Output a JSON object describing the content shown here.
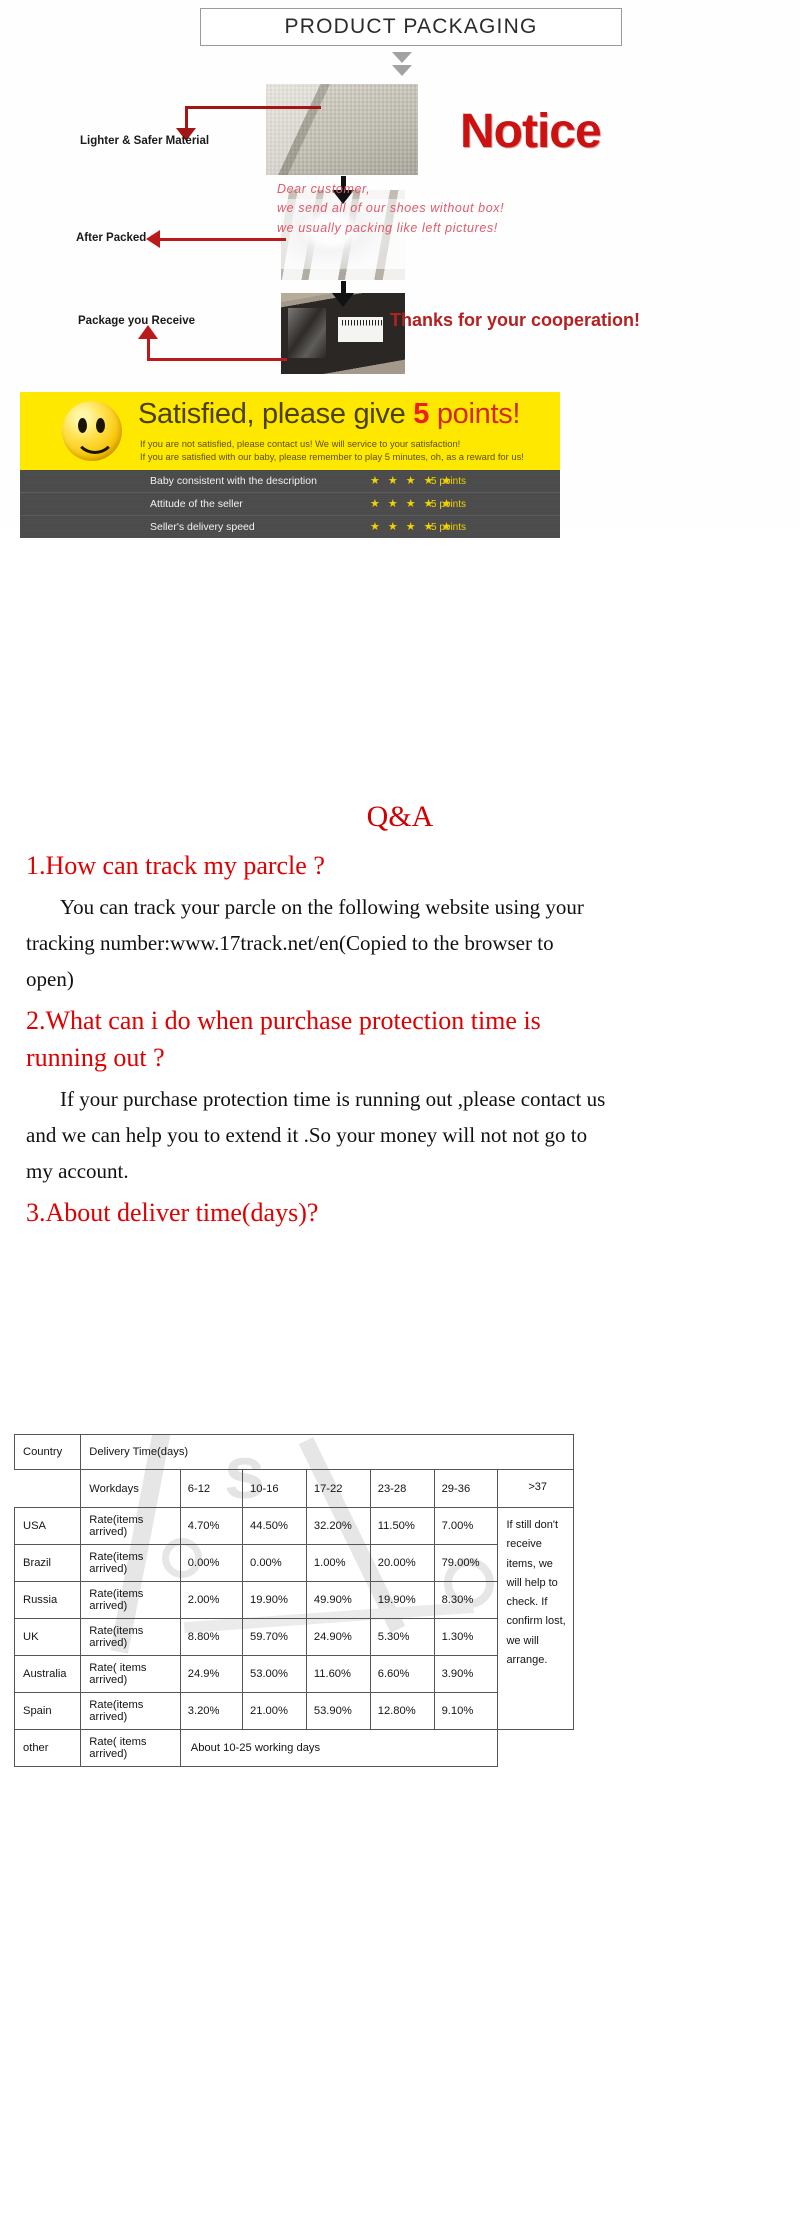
{
  "packaging": {
    "title": "PRODUCT  PACKAGING",
    "notice_heading": "Notice",
    "labels": [
      "Lighter & Safer Material",
      "After Packed",
      "Package you Receive"
    ],
    "handwriting": [
      "Dear customer,",
      "we send all of our shoes without box!",
      "we usually packing like left pictures!"
    ],
    "thanks": "Thanks for your cooperation!",
    "icons": {
      "down_arrow": "down-arrow-icon",
      "red_pointer": "red-arrow-icon"
    }
  },
  "feedback": {
    "headline_main": "Satisfied, please give ",
    "headline_points_number": "5",
    "headline_points_word": " points",
    "headline_excl": "!",
    "sub_line_1": "If you are not satisfied, please contact us! We will service to your satisfaction!",
    "sub_line_2": "If you are satisfied with our baby, please remember to play 5 minutes, oh, as a reward for us!",
    "smiley_icon": "smiley-face-icon",
    "rows": [
      {
        "label": "Baby consistent with the description",
        "stars": 5,
        "points": "5 points"
      },
      {
        "label": "Attitude of the seller",
        "stars": 5,
        "points": "5 points"
      },
      {
        "label": "Seller's delivery speed",
        "stars": 5,
        "points": "5 points"
      }
    ],
    "star_glyph": "★",
    "colors": {
      "banner": "#ffe800",
      "rows": "#4a4a4a",
      "star": "#f2d300",
      "points_red": "#ef1d1d"
    }
  },
  "qa": {
    "title": "Q&A",
    "q1": "1.How can track my parcle ?",
    "a1_line1": "You can track your parcle on the following website using your",
    "a1_line2": "tracking number:www.17track.net/en(Copied to the browser to",
    "a1_line3": "open)",
    "q2_line1": "2.What can i do when purchase protection time is",
    "q2_line2": "running out ?",
    "a2_line1": "If your purchase protection time is running out ,please contact us",
    "a2_line2": "and we can help you to extend it .So your money will not not go to",
    "a2_line3": "my account.",
    "q3": "3.About deliver time(days)?",
    "colors": {
      "question": "#e00000",
      "answer": "#111111"
    }
  },
  "delivery_table": {
    "header_country": "Country",
    "header_delivery": "Delivery   Time(days)",
    "header_workdays": "Workdays",
    "day_ranges": [
      "6-12",
      "10-16",
      "17-22",
      "23-28",
      "29-36",
      ">37"
    ],
    "rate_label": "Rate(items arrived)",
    "rate_label_alt": "Rate( items arrived)",
    "rows": [
      {
        "country": "USA",
        "rate_label": "Rate(items arrived)",
        "values": [
          "4.70%",
          "44.50%",
          "32.20%",
          "11.50%",
          "7.00%"
        ]
      },
      {
        "country": "Brazil",
        "rate_label": "Rate(items arrived)",
        "values": [
          "0.00%",
          "0.00%",
          "1.00%",
          "20.00%",
          "79.00%"
        ]
      },
      {
        "country": "Russia",
        "rate_label": "Rate(items arrived)",
        "values": [
          "2.00%",
          "19.90%",
          "49.90%",
          "19.90%",
          "8.30%"
        ]
      },
      {
        "country": "UK",
        "rate_label": "Rate(items arrived)",
        "values": [
          "8.80%",
          "59.70%",
          "24.90%",
          "5.30%",
          "1.30%"
        ]
      },
      {
        "country": "Australia",
        "rate_label": "Rate( items arrived)",
        "values": [
          "24.9%",
          "53.00%",
          "11.60%",
          "6.60%",
          "3.90%"
        ]
      },
      {
        "country": "Spain",
        "rate_label": "Rate(items arrived)",
        "values": [
          "3.20%",
          "21.00%",
          "53.90%",
          "12.80%",
          "9.10%"
        ]
      }
    ],
    "other_row": {
      "country": "other",
      "rate_label": "Rate( items arrived)",
      "value": "About 10-25 working days"
    },
    "note": "If still don't receive items, we will help to check. If confirm lost, we will arrange.",
    "watermark_text": "s"
  }
}
